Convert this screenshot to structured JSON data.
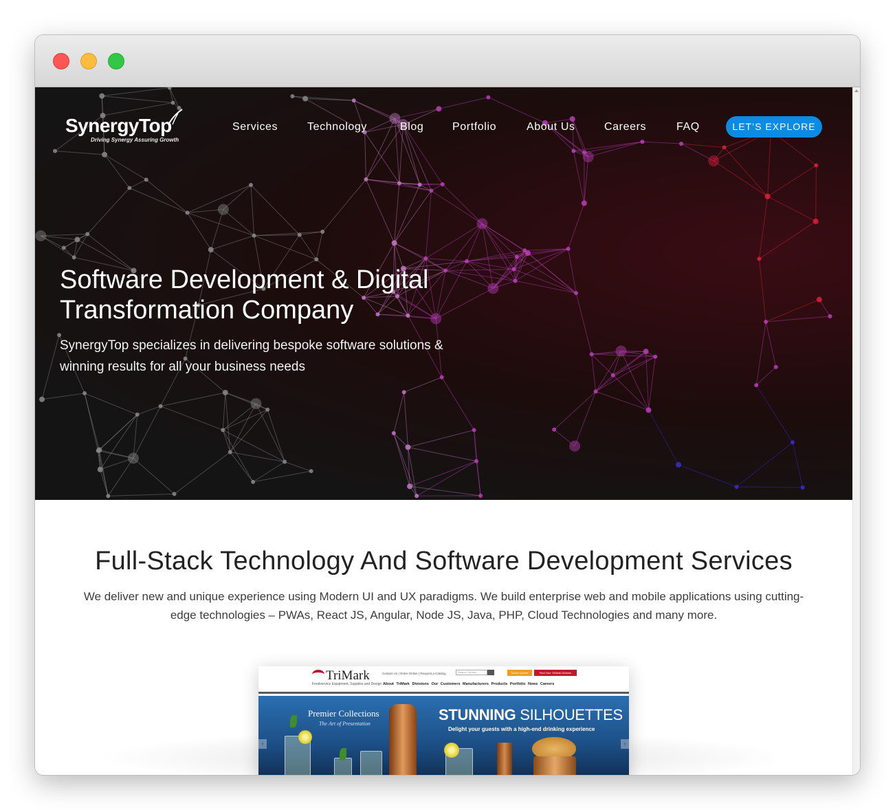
{
  "window": {
    "controls": [
      "close",
      "minimize",
      "maximize"
    ]
  },
  "brand": {
    "name": "SynergyTop",
    "tagline": "Driving Synergy Assuring Growth",
    "accent": "#0b8be3"
  },
  "nav": {
    "items": [
      "Services",
      "Technology",
      "Blog",
      "Portfolio",
      "About Us",
      "Careers",
      "FAQ"
    ],
    "cta": "LET’S EXPLORE"
  },
  "hero": {
    "title": "Software Development & Digital Transformation Company",
    "subtitle": "SynergyTop specializes in delivering bespoke software solutions & winning results for all your business needs"
  },
  "services": {
    "title": "Full-Stack Technology And Software Development Services",
    "description": "We deliver new and unique experience using Modern UI and UX paradigms. We build enterprise web and mobile applications using cutting-edge technologies – PWAs, React JS, Angular, Node JS, Java, PHP, Cloud Technologies and many more."
  },
  "portfolio_preview": {
    "logo": "TriMark",
    "logo_tag": "Foodservice Equipment, Supplies and Design",
    "utility_links": "Contact Us | Order Online | Request a Catalog",
    "search_placeholder": "Search TriMark",
    "badge_a": "Saved Quotes",
    "badge_b": "Find Your TriMark Division",
    "nav": "About TriMark   Divisions   Our Customers   Manufacturers   Products   Portfolio   News   Careers",
    "banner_left_title": "Premier Collections",
    "banner_left_sub": "The Art of Presentation",
    "banner_right_title_bold": "STUNNING",
    "banner_right_title_rest": " SILHOUETTES",
    "banner_right_sub": "Delight your guests with a high-end drinking experience"
  }
}
